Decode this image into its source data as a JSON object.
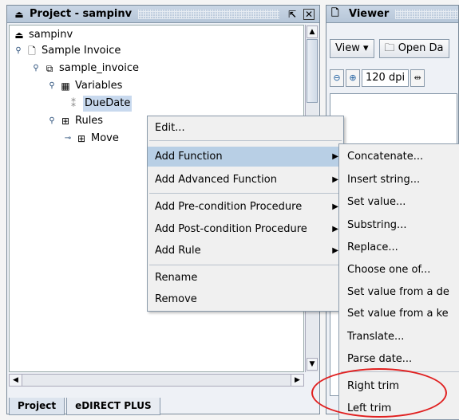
{
  "project_panel": {
    "title": "Project - sampinv",
    "icons": {
      "title": "eject-icon",
      "maximize": "maximize-icon",
      "close": "close-box-icon"
    }
  },
  "tree": {
    "root": "sampinv",
    "invoice": "Sample Invoice",
    "sample_invoice": "sample_invoice",
    "variables": "Variables",
    "duedate": "DueDate",
    "rules": "Rules",
    "move": "Move"
  },
  "tabs": [
    "Project",
    "eDIRECT PLUS"
  ],
  "viewer": {
    "title": "Viewer",
    "view_button": "View",
    "open_button": "Open Da",
    "dpi": "120 dpi"
  },
  "context_menu": {
    "items": [
      {
        "label": "Edit..."
      },
      {
        "label": "Add Function",
        "submenu": true
      },
      {
        "label": "Add Advanced Function",
        "submenu": true
      },
      {
        "label": "Add Pre-condition Procedure",
        "submenu": true
      },
      {
        "label": "Add Post-condition Procedure",
        "submenu": true
      },
      {
        "label": "Add Rule",
        "submenu": true
      },
      {
        "label": "Rename"
      },
      {
        "label": "Remove"
      }
    ]
  },
  "submenu": {
    "items": [
      "Concatenate...",
      "Insert string...",
      "Set value...",
      "Substring...",
      "Replace...",
      "Choose one of...",
      "Set value from a de",
      "Set value from a ke",
      "Translate...",
      "Parse date...",
      "Right trim",
      "Left trim"
    ]
  },
  "colors": {
    "highlight": "#b8cfe5",
    "annotation": "#e02020",
    "title_bar": "#c0cfe0"
  }
}
